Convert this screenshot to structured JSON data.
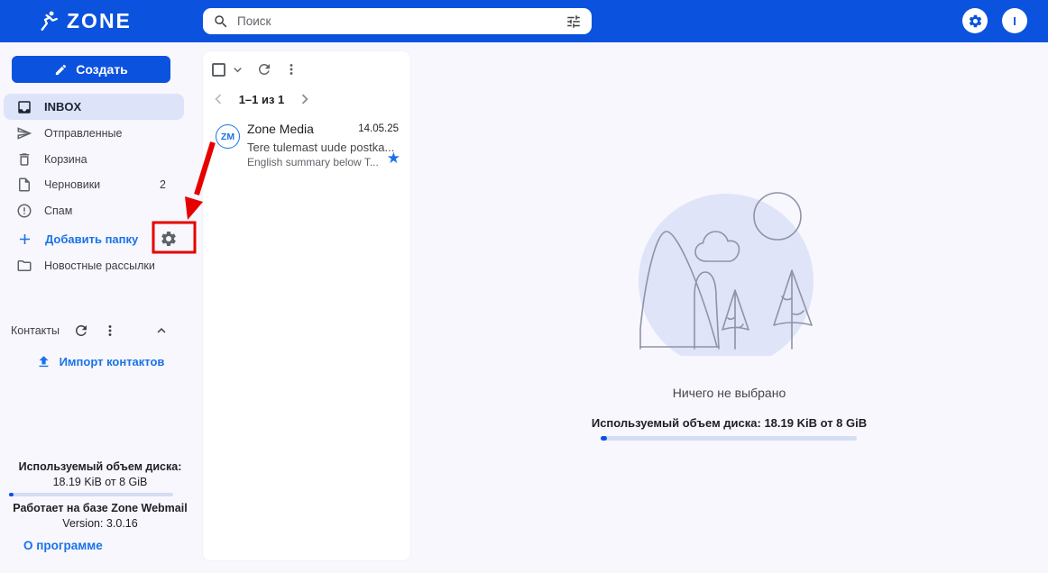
{
  "topbar": {
    "brand": "ZONE",
    "logo_icon": "runner-icon",
    "search": {
      "placeholder": "Поиск",
      "icon": "search-icon",
      "filter_icon": "tune-icon"
    },
    "settings_icon": "gear-icon",
    "avatar_initial": "I"
  },
  "sidebar": {
    "compose_label": "Создать",
    "compose_icon": "pencil-icon",
    "folders": [
      {
        "label": "INBOX",
        "icon": "inbox-icon",
        "selected": true
      },
      {
        "label": "Отправленные",
        "icon": "send-icon"
      },
      {
        "label": "Корзина",
        "icon": "trash-icon"
      },
      {
        "label": "Черновики",
        "icon": "draft-icon",
        "count": "2"
      },
      {
        "label": "Спам",
        "icon": "spam-icon"
      }
    ],
    "add_folder": {
      "label": "Добавить папку",
      "icon": "plus-icon",
      "settings_icon": "gear-icon"
    },
    "newsletters": {
      "label": "Новостные рассылки",
      "icon": "folder-icon"
    },
    "contacts": {
      "title": "Контакты",
      "icons": [
        "refresh-icon",
        "kebab-icon",
        "chevron-up-icon"
      ],
      "import_label": "Импорт контактов",
      "import_icon": "upload-icon"
    },
    "quota": {
      "label": "Используемый объем диска:",
      "value": "18.19 KiB от 8 GiB"
    },
    "powered_by": "Работает на базе Zone Webmail",
    "version": "Version: 3.0.16",
    "about_label": "О программе"
  },
  "message_list": {
    "toolbar_icons": [
      "checkbox",
      "chevron-down-icon",
      "refresh-icon",
      "kebab-icon"
    ],
    "pagination": {
      "label": "1–1 из 1",
      "prev_icon": "chevron-left-icon",
      "next_icon": "chevron-right-icon"
    },
    "emails": [
      {
        "avatar_initials": "ZM",
        "sender": "Zone Media",
        "date": "14.05.25",
        "subject": "Tere tulemast uude postka...",
        "preview": "English summary below T...",
        "starred": true,
        "star_icon": "star-icon"
      }
    ]
  },
  "main": {
    "empty_state_text": "Ничего не выбрано",
    "quota_text": "Используемый объем диска: 18.19 KiB от 8 GiB",
    "illustration": "landscape-illustration"
  },
  "annotation": {
    "type": "red-arrow-and-box",
    "target": "folder-settings-gear"
  },
  "colors": {
    "topbar_blue": "#0b53de",
    "accent_blue": "#1a73e8",
    "selected_folder_bg": "#dde3f9",
    "annotation_red": "#e60000",
    "illustration_fill": "#dfe4f9",
    "progress_track": "#d3ddf3",
    "progress_fill": "#0b53de",
    "text_primary": "#1f1f1f",
    "text_secondary": "#5f6368",
    "panel_bg": "#ffffff",
    "page_bg": "#f7f7fd"
  }
}
